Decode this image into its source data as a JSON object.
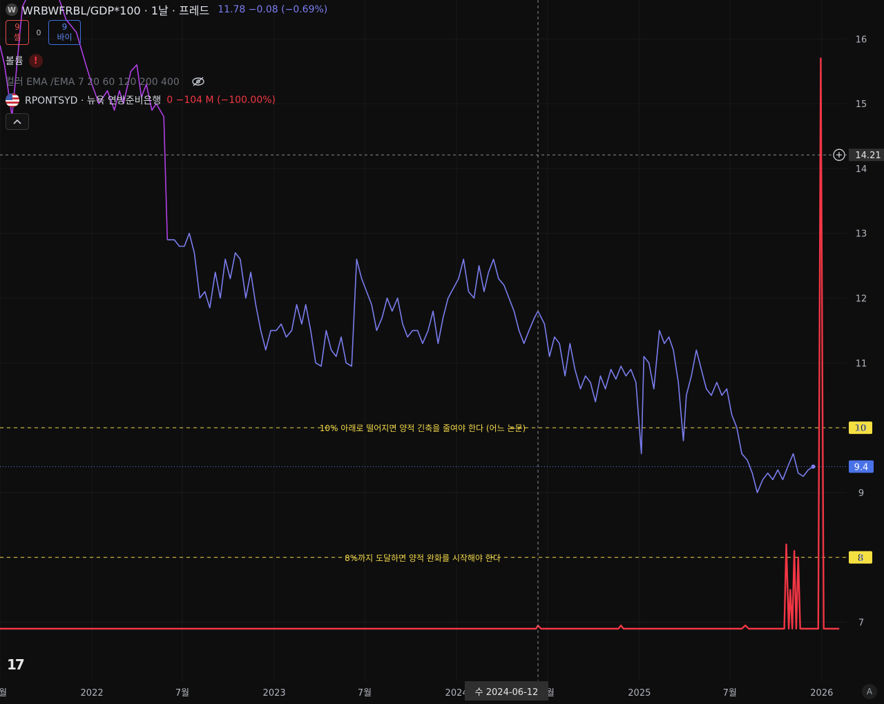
{
  "header": {
    "badge": "W",
    "title": "WRBWFRBL/GDP*100 · 1날 · 프레드",
    "values": "11.78  −0.08 (−0.69%)"
  },
  "trade": {
    "sell_value": "9",
    "sell_label": "셀",
    "spread": "0",
    "buy_value": "9",
    "buy_label": "바이"
  },
  "volume": {
    "label": "볼륨",
    "warning_icon": "!"
  },
  "ema": {
    "label": "컬러 EMA /EMA 7 20 60 120 200 400"
  },
  "rpontsyd": {
    "name": "RPONTSYD · 뉴욕 연방준비은행",
    "values": "0  −104 M (−100.00%)"
  },
  "collapse_icon": "chevron-up",
  "logo": "17",
  "auto_button": "A",
  "crosshair": {
    "date_label": "수 2024-06-12",
    "price_label": "14.21"
  },
  "colors": {
    "background": "#0e0e0e",
    "ratio_line_early": "#b040e6",
    "ratio_line": "#7b7ef0",
    "rpontsyd_line": "#f23645",
    "annotation": "#f2d84a",
    "last_price": "#5a86f0"
  },
  "chart_data": {
    "type": "line",
    "ylim": [
      6.1,
      16.6
    ],
    "y_ticks": [
      16,
      15,
      14,
      13,
      12,
      11,
      10,
      9,
      8,
      7
    ],
    "x_ticks": [
      "7월",
      "2022",
      "7월",
      "2023",
      "7월",
      "2024",
      "7월",
      "2025",
      "7월",
      "2026"
    ],
    "x_tick_dates": [
      "2021-07-01",
      "2022-01-01",
      "2022-07-01",
      "2023-01-01",
      "2023-07-01",
      "2024-01-01",
      "2024-07-01",
      "2025-01-01",
      "2025-07-01",
      "2026-01-01"
    ],
    "x_domain": [
      "2021-07-01",
      "2026-02-20"
    ],
    "hlines": [
      {
        "value": 10,
        "label": "10% 아래로 떨어지면 양적 긴축을 줄여야 한다 (어느 논문)",
        "tag": "10"
      },
      {
        "value": 8,
        "label": "8%까지 도달하면 양적 완화를 시작해야 한다",
        "tag": "8"
      }
    ],
    "last_value": {
      "value": 9.4,
      "tag": "9.4"
    },
    "series": [
      {
        "name": "WRBWFRBL/GDP*100",
        "points": [
          [
            "2021-07-01",
            15.9
          ],
          [
            "2021-07-10",
            15.6
          ],
          [
            "2021-07-25",
            14.8
          ],
          [
            "2021-08-15",
            16.5
          ],
          [
            "2021-09-10",
            16.9
          ],
          [
            "2021-10-15",
            16.9
          ],
          [
            "2021-11-10",
            16.3
          ],
          [
            "2021-12-01",
            16.1
          ],
          [
            "2021-12-20",
            15.6
          ],
          [
            "2022-01-01",
            15.3
          ],
          [
            "2022-01-15",
            15.0
          ],
          [
            "2022-02-01",
            15.2
          ],
          [
            "2022-02-15",
            14.9
          ],
          [
            "2022-02-25",
            15.2
          ],
          [
            "2022-03-05",
            15.0
          ],
          [
            "2022-03-20",
            15.5
          ],
          [
            "2022-04-01",
            15.6
          ],
          [
            "2022-04-10",
            15.1
          ],
          [
            "2022-04-20",
            15.3
          ],
          [
            "2022-05-01",
            14.9
          ],
          [
            "2022-05-10",
            15.0
          ],
          [
            "2022-05-25",
            14.8
          ],
          [
            "2022-06-01",
            12.9
          ],
          [
            "2022-06-15",
            12.9
          ],
          [
            "2022-06-25",
            12.8
          ],
          [
            "2022-07-05",
            12.8
          ],
          [
            "2022-07-15",
            13.0
          ],
          [
            "2022-07-25",
            12.7
          ],
          [
            "2022-08-05",
            12.0
          ],
          [
            "2022-08-15",
            12.1
          ],
          [
            "2022-08-25",
            11.85
          ],
          [
            "2022-09-05",
            12.4
          ],
          [
            "2022-09-15",
            12.0
          ],
          [
            "2022-09-25",
            12.6
          ],
          [
            "2022-10-05",
            12.3
          ],
          [
            "2022-10-15",
            12.7
          ],
          [
            "2022-10-25",
            12.6
          ],
          [
            "2022-11-05",
            12.0
          ],
          [
            "2022-11-15",
            12.4
          ],
          [
            "2022-11-25",
            11.9
          ],
          [
            "2022-12-05",
            11.5
          ],
          [
            "2022-12-15",
            11.2
          ],
          [
            "2022-12-25",
            11.5
          ],
          [
            "2023-01-05",
            11.5
          ],
          [
            "2023-01-15",
            11.6
          ],
          [
            "2023-01-25",
            11.4
          ],
          [
            "2023-02-05",
            11.5
          ],
          [
            "2023-02-15",
            11.9
          ],
          [
            "2023-02-25",
            11.6
          ],
          [
            "2023-03-05",
            11.9
          ],
          [
            "2023-03-15",
            11.5
          ],
          [
            "2023-03-25",
            11.0
          ],
          [
            "2023-04-05",
            10.95
          ],
          [
            "2023-04-15",
            11.5
          ],
          [
            "2023-04-25",
            11.2
          ],
          [
            "2023-05-05",
            11.1
          ],
          [
            "2023-05-15",
            11.4
          ],
          [
            "2023-05-25",
            11.0
          ],
          [
            "2023-06-05",
            10.95
          ],
          [
            "2023-06-15",
            12.6
          ],
          [
            "2023-06-25",
            12.3
          ],
          [
            "2023-07-05",
            12.1
          ],
          [
            "2023-07-15",
            11.9
          ],
          [
            "2023-07-25",
            11.5
          ],
          [
            "2023-08-05",
            11.7
          ],
          [
            "2023-08-15",
            12.0
          ],
          [
            "2023-08-25",
            11.8
          ],
          [
            "2023-09-05",
            12.0
          ],
          [
            "2023-09-15",
            11.6
          ],
          [
            "2023-09-25",
            11.4
          ],
          [
            "2023-10-05",
            11.5
          ],
          [
            "2023-10-15",
            11.5
          ],
          [
            "2023-10-25",
            11.3
          ],
          [
            "2023-11-05",
            11.5
          ],
          [
            "2023-11-15",
            11.8
          ],
          [
            "2023-11-25",
            11.3
          ],
          [
            "2023-12-05",
            11.7
          ],
          [
            "2023-12-15",
            12.0
          ],
          [
            "2024-01-05",
            12.3
          ],
          [
            "2024-01-15",
            12.6
          ],
          [
            "2024-01-25",
            12.1
          ],
          [
            "2024-02-05",
            12.0
          ],
          [
            "2024-02-15",
            12.5
          ],
          [
            "2024-02-25",
            12.1
          ],
          [
            "2024-03-05",
            12.4
          ],
          [
            "2024-03-15",
            12.6
          ],
          [
            "2024-03-25",
            12.3
          ],
          [
            "2024-04-05",
            12.2
          ],
          [
            "2024-04-15",
            12.0
          ],
          [
            "2024-04-25",
            11.8
          ],
          [
            "2024-05-05",
            11.5
          ],
          [
            "2024-05-15",
            11.3
          ],
          [
            "2024-05-25",
            11.5
          ],
          [
            "2024-06-05",
            11.7
          ],
          [
            "2024-06-12",
            11.8
          ],
          [
            "2024-06-25",
            11.6
          ],
          [
            "2024-07-05",
            11.1
          ],
          [
            "2024-07-15",
            11.4
          ],
          [
            "2024-07-25",
            11.3
          ],
          [
            "2024-08-05",
            10.8
          ],
          [
            "2024-08-15",
            11.3
          ],
          [
            "2024-08-25",
            10.9
          ],
          [
            "2024-09-05",
            10.6
          ],
          [
            "2024-09-15",
            10.8
          ],
          [
            "2024-09-25",
            10.7
          ],
          [
            "2024-10-05",
            10.4
          ],
          [
            "2024-10-15",
            10.8
          ],
          [
            "2024-10-25",
            10.6
          ],
          [
            "2024-11-05",
            10.9
          ],
          [
            "2024-11-15",
            10.75
          ],
          [
            "2024-11-25",
            10.95
          ],
          [
            "2024-12-05",
            10.8
          ],
          [
            "2024-12-15",
            10.9
          ],
          [
            "2024-12-25",
            10.7
          ],
          [
            "2025-01-05",
            9.6
          ],
          [
            "2025-01-10",
            11.1
          ],
          [
            "2025-01-20",
            11.0
          ],
          [
            "2025-01-30",
            10.6
          ],
          [
            "2025-02-10",
            11.5
          ],
          [
            "2025-02-20",
            11.3
          ],
          [
            "2025-03-01",
            11.4
          ],
          [
            "2025-03-10",
            11.2
          ],
          [
            "2025-03-20",
            10.7
          ],
          [
            "2025-03-30",
            9.8
          ],
          [
            "2025-04-05",
            10.5
          ],
          [
            "2025-04-15",
            10.8
          ],
          [
            "2025-04-25",
            11.2
          ],
          [
            "2025-05-05",
            10.9
          ],
          [
            "2025-05-15",
            10.6
          ],
          [
            "2025-05-25",
            10.5
          ],
          [
            "2025-06-05",
            10.7
          ],
          [
            "2025-06-15",
            10.5
          ],
          [
            "2025-06-25",
            10.6
          ],
          [
            "2025-07-05",
            10.2
          ],
          [
            "2025-07-15",
            10.0
          ],
          [
            "2025-07-25",
            9.6
          ],
          [
            "2025-08-05",
            9.5
          ],
          [
            "2025-08-15",
            9.3
          ],
          [
            "2025-08-25",
            9.0
          ],
          [
            "2025-09-05",
            9.2
          ],
          [
            "2025-09-15",
            9.3
          ],
          [
            "2025-09-25",
            9.2
          ],
          [
            "2025-10-05",
            9.35
          ],
          [
            "2025-10-15",
            9.2
          ],
          [
            "2025-10-25",
            9.4
          ],
          [
            "2025-11-05",
            9.6
          ],
          [
            "2025-11-15",
            9.3
          ],
          [
            "2025-11-25",
            9.25
          ],
          [
            "2025-12-05",
            9.35
          ],
          [
            "2025-12-15",
            9.4
          ]
        ]
      },
      {
        "name": "RPONTSYD",
        "points": [
          [
            "2021-07-01",
            6.9
          ],
          [
            "2024-06-08",
            6.9
          ],
          [
            "2024-06-12",
            6.95
          ],
          [
            "2024-06-18",
            6.9
          ],
          [
            "2024-11-20",
            6.9
          ],
          [
            "2024-11-25",
            6.95
          ],
          [
            "2024-11-30",
            6.9
          ],
          [
            "2025-07-25",
            6.9
          ],
          [
            "2025-08-01",
            6.95
          ],
          [
            "2025-08-08",
            6.9
          ],
          [
            "2025-10-18",
            6.9
          ],
          [
            "2025-10-22",
            8.2
          ],
          [
            "2025-10-27",
            6.9
          ],
          [
            "2025-10-30",
            7.5
          ],
          [
            "2025-11-03",
            6.9
          ],
          [
            "2025-11-07",
            8.1
          ],
          [
            "2025-11-11",
            6.9
          ],
          [
            "2025-11-15",
            8.0
          ],
          [
            "2025-11-19",
            6.9
          ],
          [
            "2025-12-25",
            6.9
          ],
          [
            "2025-12-30",
            15.7
          ],
          [
            "2026-01-05",
            6.9
          ],
          [
            "2026-02-05",
            6.9
          ]
        ]
      }
    ]
  }
}
